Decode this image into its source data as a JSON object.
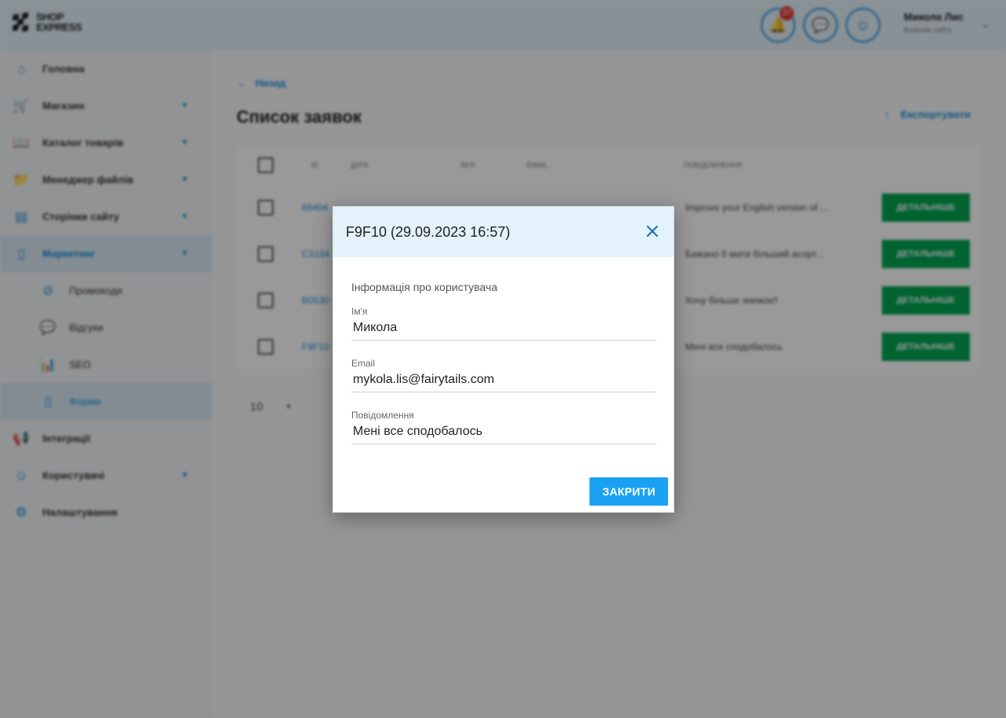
{
  "header": {
    "logo_top": "SHOP",
    "logo_bottom": "EXPRESS",
    "notifications_count": "37",
    "user_name": "Микола Лис",
    "user_role": "Власник сайту"
  },
  "sidebar": {
    "items": [
      {
        "label": "Головна",
        "icon": "home-icon"
      },
      {
        "label": "Магазин",
        "icon": "cart-icon"
      },
      {
        "label": "Каталог товарів",
        "icon": "book-icon"
      },
      {
        "label": "Менеджер файлів",
        "icon": "folder-icon"
      },
      {
        "label": "Сторінки сайту",
        "icon": "pages-icon"
      },
      {
        "label": "Маркетинг",
        "icon": "marketing-icon"
      },
      {
        "label": "Промокоди",
        "icon": "promo-icon"
      },
      {
        "label": "Відгуки",
        "icon": "reviews-icon"
      },
      {
        "label": "SEO",
        "icon": "seo-icon"
      },
      {
        "label": "Форми",
        "icon": "forms-icon"
      },
      {
        "label": "Інтеграції",
        "icon": "integrations-icon"
      },
      {
        "label": "Користувачі",
        "icon": "users-icon"
      },
      {
        "label": "Налаштування",
        "icon": "settings-icon"
      }
    ]
  },
  "main": {
    "back_label": "Назад",
    "title": "Список заявок",
    "export_label": "Експортувати",
    "table": {
      "columns": [
        "ID",
        "Дата",
        "Ім'я",
        "Email",
        "Повідомлення"
      ],
      "rows": [
        {
          "id": "66404",
          "message": "Improve your English version of ...",
          "action": "ДЕТАЛЬНІШЕ"
        },
        {
          "id": "C3194",
          "message": "Бажано б мати більший асорт...",
          "action": "ДЕТАЛЬНІШЕ"
        },
        {
          "id": "B0530",
          "message": "Хочу більше знижок!!",
          "action": "ДЕТАЛЬНІШЕ"
        },
        {
          "id": "F9F10",
          "message": "Мені все сподобалось",
          "action": "ДЕТАЛЬНІШЕ"
        }
      ]
    },
    "page_size": "10"
  },
  "modal": {
    "title": "F9F10 (29.09.2023 16:57)",
    "section_title": "Інформація про користувача",
    "fields": {
      "name_label": "Ім'я",
      "name_value": "Микола",
      "email_label": "Email",
      "email_value": "mykola.lis@fairytails.com",
      "message_label": "Повідомлення",
      "message_value": "Мені все сподобалось"
    },
    "close_button": "ЗАКРИТИ"
  },
  "colors": {
    "accent": "#1a8ed8",
    "header_bg": "#e3f2fb",
    "button_primary": "#1ba1f2",
    "button_details": "#00a651"
  }
}
